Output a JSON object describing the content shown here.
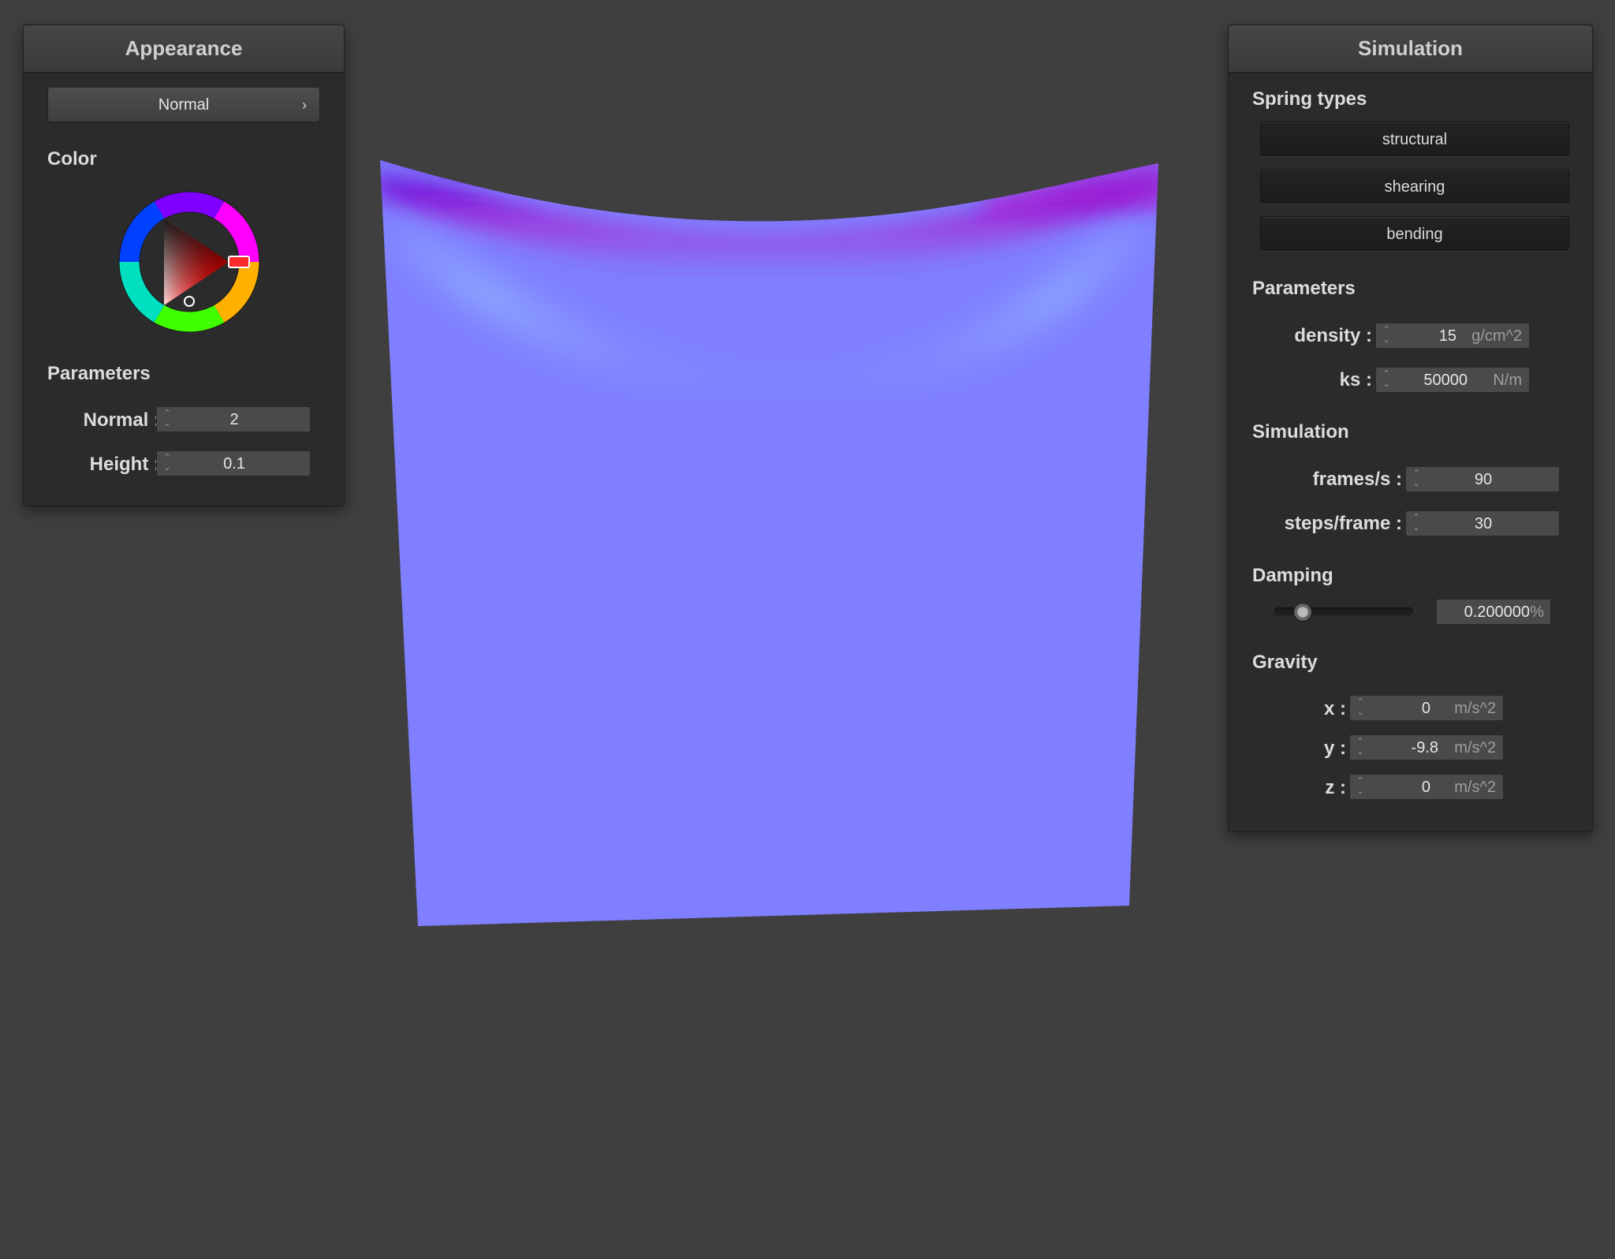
{
  "appearance": {
    "title": "Appearance",
    "shader_dropdown": "Normal",
    "color_section": "Color",
    "params_section": "Parameters",
    "normal": {
      "label": "Normal :",
      "value": "2"
    },
    "height": {
      "label": "Height :",
      "value": "0.1"
    },
    "selected_hue": "#ff0000"
  },
  "simulation": {
    "title": "Simulation",
    "spring_section": "Spring types",
    "springs": [
      "structural",
      "shearing",
      "bending"
    ],
    "params_section": "Parameters",
    "density": {
      "label": "density :",
      "value": "15",
      "unit": "g/cm^2"
    },
    "ks": {
      "label": "ks :",
      "value": "50000",
      "unit": "N/m"
    },
    "sim_section": "Simulation",
    "fps": {
      "label": "frames/s :",
      "value": "90"
    },
    "steps": {
      "label": "steps/frame :",
      "value": "30"
    },
    "damping_section": "Damping",
    "damping": {
      "value": "0.200000",
      "unit": "%",
      "slider_fraction": 0.2
    },
    "gravity_section": "Gravity",
    "gravity": {
      "x": {
        "label": "x :",
        "value": "0",
        "unit": "m/s^2"
      },
      "y": {
        "label": "y :",
        "value": "-9.8",
        "unit": "m/s^2"
      },
      "z": {
        "label": "z :",
        "value": "0",
        "unit": "m/s^2"
      }
    }
  },
  "colors": {
    "background": "#3f3f3f",
    "cloth": "#7f7fff",
    "cloth_fold": "#8a1fd6"
  }
}
